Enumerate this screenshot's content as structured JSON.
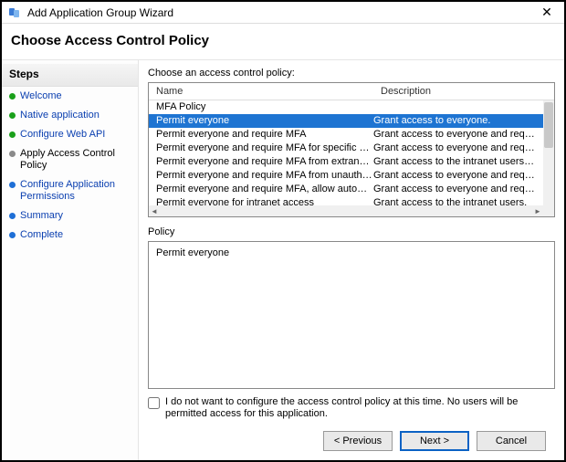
{
  "window": {
    "title": "Add Application Group Wizard"
  },
  "header": {
    "title": "Choose Access Control Policy"
  },
  "sidebar": {
    "title": "Steps",
    "items": [
      {
        "label": "Welcome",
        "state": "done",
        "link": true
      },
      {
        "label": "Native application",
        "state": "done",
        "link": true
      },
      {
        "label": "Configure Web API",
        "state": "done",
        "link": true
      },
      {
        "label": "Apply Access Control Policy",
        "state": "current",
        "link": false
      },
      {
        "label": "Configure Application Permissions",
        "state": "todo",
        "link": true
      },
      {
        "label": "Summary",
        "state": "todo",
        "link": true
      },
      {
        "label": "Complete",
        "state": "todo",
        "link": true
      }
    ]
  },
  "main": {
    "prompt": "Choose an access control policy:",
    "columns": {
      "name": "Name",
      "description": "Description"
    },
    "rows": [
      {
        "name": "MFA Policy",
        "description": ""
      },
      {
        "name": "Permit everyone",
        "description": "Grant access to everyone.",
        "selected": true
      },
      {
        "name": "Permit everyone and require MFA",
        "description": "Grant access to everyone and require MFA f..."
      },
      {
        "name": "Permit everyone and require MFA for specific group",
        "description": "Grant access to everyone and require MFA f..."
      },
      {
        "name": "Permit everyone and require MFA from extranet access",
        "description": "Grant access to the intranet users and requir..."
      },
      {
        "name": "Permit everyone and require MFA from unauthenticated ...",
        "description": "Grant access to everyone and require MFA f..."
      },
      {
        "name": "Permit everyone and require MFA, allow automatic devi...",
        "description": "Grant access to everyone and require MFA f..."
      },
      {
        "name": "Permit everyone for intranet access",
        "description": "Grant access to the intranet users."
      }
    ],
    "policy_label": "Policy",
    "policy_text": "Permit everyone",
    "skip_label": "I do not want to configure the access control policy at this time.  No users will be permitted access for this application."
  },
  "footer": {
    "previous": "< Previous",
    "next": "Next >",
    "cancel": "Cancel"
  }
}
